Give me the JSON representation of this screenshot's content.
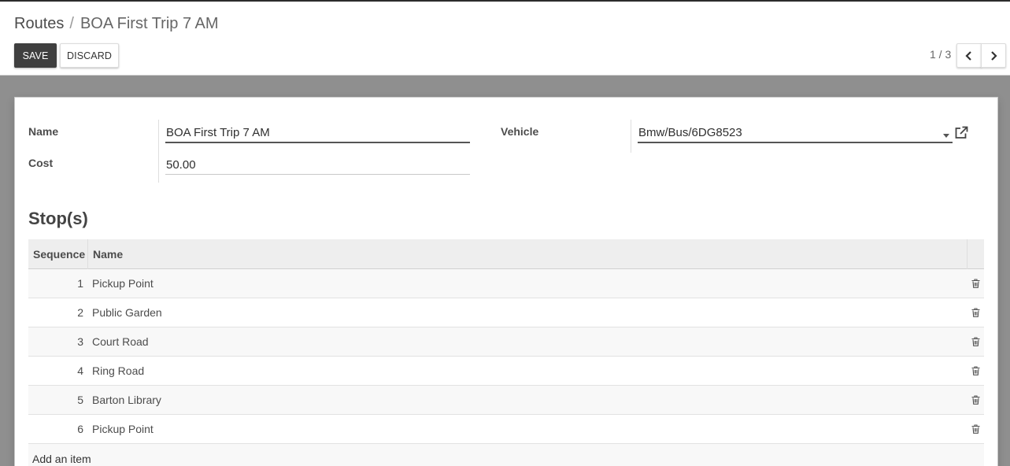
{
  "breadcrumb": {
    "parent": "Routes",
    "separator": "/",
    "current": "BOA First Trip 7 AM"
  },
  "toolbar": {
    "save_label": "SAVE",
    "discard_label": "DISCARD"
  },
  "pager": {
    "value": "1 / 3"
  },
  "form": {
    "name_label": "Name",
    "name_value": "BOA First Trip 7 AM",
    "cost_label": "Cost",
    "cost_value": "50.00",
    "vehicle_label": "Vehicle",
    "vehicle_value": "Bmw/Bus/6DG8523"
  },
  "stops": {
    "title": "Stop(s)",
    "columns": {
      "sequence": "Sequence",
      "name": "Name"
    },
    "rows": [
      {
        "seq": "1",
        "name": "Pickup Point"
      },
      {
        "seq": "2",
        "name": "Public Garden"
      },
      {
        "seq": "3",
        "name": "Court Road"
      },
      {
        "seq": "4",
        "name": "Ring Road"
      },
      {
        "seq": "5",
        "name": "Barton Library"
      },
      {
        "seq": "6",
        "name": "Pickup Point"
      }
    ],
    "add_label": "Add an item"
  },
  "icons": {
    "pager_prev": "chevron-left-icon",
    "pager_next": "chevron-right-icon",
    "dropdown": "caret-down-icon",
    "external": "external-link-icon",
    "delete": "trash-icon"
  },
  "colors": {
    "save_button": "#3f3f3f",
    "background": "#8f8f8f"
  }
}
